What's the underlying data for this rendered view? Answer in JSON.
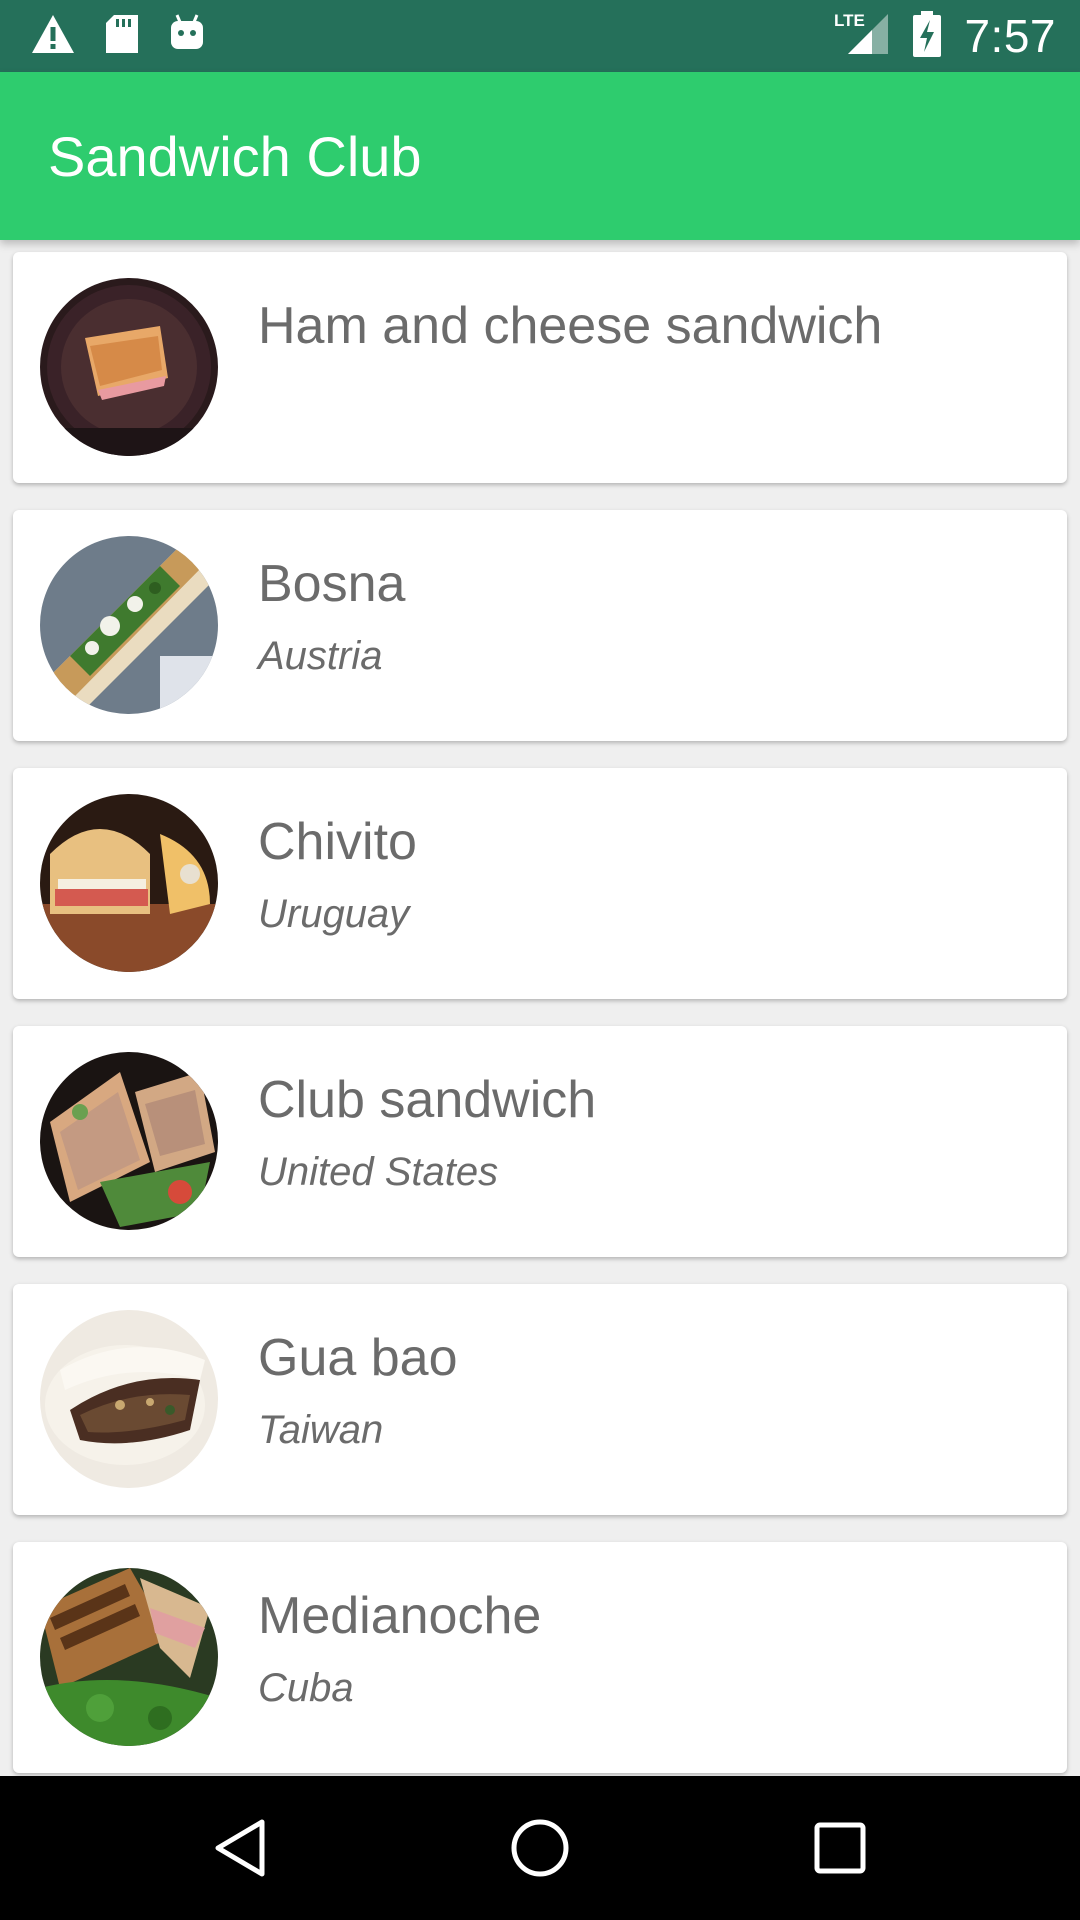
{
  "status_bar": {
    "time": "7:57",
    "network": "LTE",
    "left_icons": [
      "warning-icon",
      "sd-card-icon",
      "android-icon"
    ],
    "right_icons": [
      "lte-signal-icon",
      "battery-charging-icon"
    ]
  },
  "app_bar": {
    "title": "Sandwich Club",
    "color": "#2ecc6e"
  },
  "sandwiches": [
    {
      "name": "Ham and cheese sandwich",
      "origin": ""
    },
    {
      "name": "Bosna",
      "origin": "Austria"
    },
    {
      "name": "Chivito",
      "origin": "Uruguay"
    },
    {
      "name": "Club sandwich",
      "origin": "United States"
    },
    {
      "name": "Gua bao",
      "origin": "Taiwan"
    },
    {
      "name": "Medianoche",
      "origin": "Cuba"
    }
  ],
  "nav_bar": {
    "buttons": [
      "back-icon",
      "home-icon",
      "recents-icon"
    ]
  },
  "colors": {
    "status_bar": "#25705a",
    "accent": "#2ecc6e",
    "text": "#6b6b6b"
  }
}
